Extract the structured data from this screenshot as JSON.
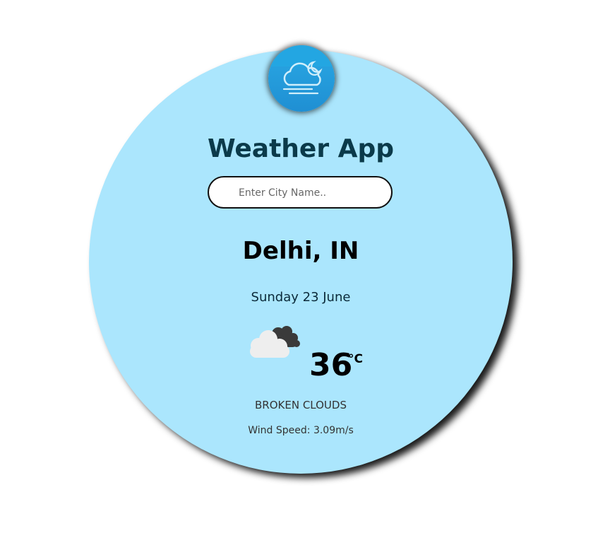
{
  "app": {
    "title": "Weather App",
    "logo_icon": "cloud-moon-wind-icon"
  },
  "search": {
    "placeholder": "Enter City Name..",
    "value": ""
  },
  "weather": {
    "location": "Delhi, IN",
    "date": "Sunday 23 June",
    "icon": "broken-clouds-icon",
    "temperature": "36",
    "unit": "°C",
    "description": "BROKEN CLOUDS",
    "wind_label": "Wind Speed:",
    "wind_value": "3.09m/s"
  },
  "colors": {
    "circle_bg": "#abe6fd",
    "badge_bg": "#1f8fd3",
    "title_color": "#0b3a4a"
  }
}
